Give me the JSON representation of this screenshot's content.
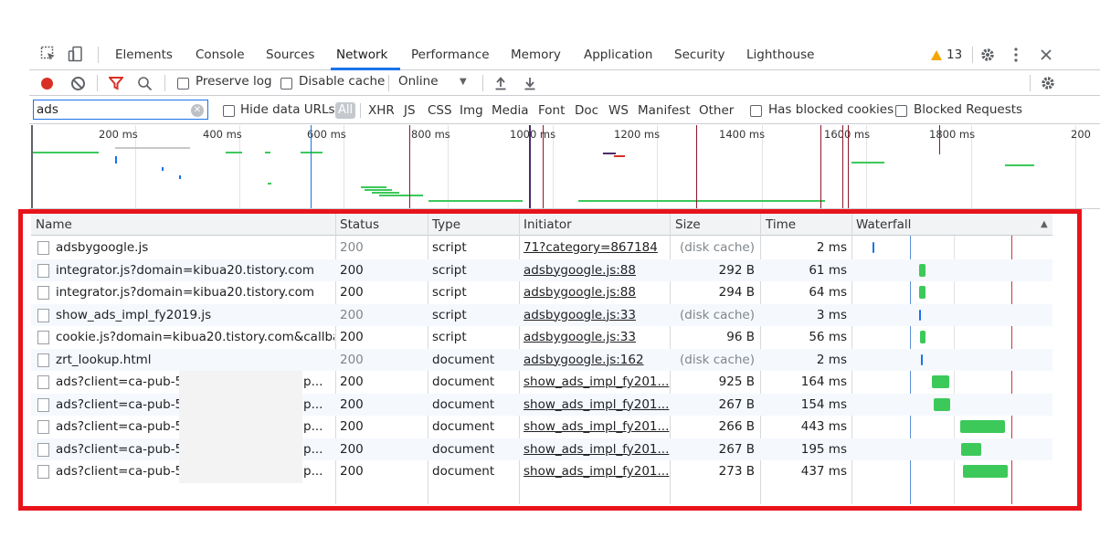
{
  "tabs": [
    "Elements",
    "Console",
    "Sources",
    "Network",
    "Performance",
    "Memory",
    "Application",
    "Security",
    "Lighthouse"
  ],
  "active_tab": "Network",
  "warning_count": "13",
  "toolbar": {
    "preserve_log": "Preserve log",
    "disable_cache": "Disable cache",
    "throttling": "Online"
  },
  "filter": {
    "value": "ads",
    "hide_data_urls": "Hide data URLs",
    "all_label": "All",
    "types": [
      "XHR",
      "JS",
      "CSS",
      "Img",
      "Media",
      "Font",
      "Doc",
      "WS",
      "Manifest",
      "Other"
    ],
    "has_blocked_cookies": "Has blocked cookies",
    "blocked_requests": "Blocked Requests"
  },
  "overview": {
    "ticks": [
      "200 ms",
      "400 ms",
      "600 ms",
      "800 ms",
      "1000 ms",
      "1200 ms",
      "1400 ms",
      "1600 ms",
      "1800 ms",
      "200"
    ]
  },
  "table": {
    "headers": [
      "Name",
      "Status",
      "Type",
      "Initiator",
      "Size",
      "Time",
      "Waterfall"
    ],
    "sort_icon": "▲",
    "rows": [
      {
        "name": "adsbygoogle.js",
        "name_suffix": "",
        "status": "200",
        "type": "script",
        "initiator": "71?category=867184",
        "size": "(disk cache)",
        "time": "2 ms",
        "masked": false,
        "gray_status": true
      },
      {
        "name": "integrator.js?domain=kibua20.tistory.com",
        "name_suffix": "",
        "status": "200",
        "type": "script",
        "initiator": "adsbygoogle.js:88",
        "size": "292 B",
        "time": "61 ms",
        "masked": false,
        "gray_status": false
      },
      {
        "name": "integrator.js?domain=kibua20.tistory.com",
        "name_suffix": "",
        "status": "200",
        "type": "script",
        "initiator": "adsbygoogle.js:88",
        "size": "294 B",
        "time": "64 ms",
        "masked": false,
        "gray_status": false
      },
      {
        "name": "show_ads_impl_fy2019.js",
        "name_suffix": "",
        "status": "200",
        "type": "script",
        "initiator": "adsbygoogle.js:33",
        "size": "(disk cache)",
        "time": "3 ms",
        "masked": false,
        "gray_status": true
      },
      {
        "name": "cookie.js?domain=kibua20.tistory.com&callba...",
        "name_suffix": "",
        "status": "200",
        "type": "script",
        "initiator": "adsbygoogle.js:33",
        "size": "96 B",
        "time": "56 ms",
        "masked": false,
        "gray_status": false
      },
      {
        "name": "zrt_lookup.html",
        "name_suffix": "",
        "status": "200",
        "type": "document",
        "initiator": "adsbygoogle.js:162",
        "size": "(disk cache)",
        "time": "2 ms",
        "masked": false,
        "gray_status": true
      },
      {
        "name": "ads?client=ca-pub-51!",
        "name_suffix": "p...",
        "status": "200",
        "type": "document",
        "initiator": "show_ads_impl_fy201...",
        "size": "925 B",
        "time": "164 ms",
        "masked": true,
        "gray_status": false
      },
      {
        "name": "ads?client=ca-pub-51!",
        "name_suffix": "p...",
        "status": "200",
        "type": "document",
        "initiator": "show_ads_impl_fy201...",
        "size": "267 B",
        "time": "154 ms",
        "masked": true,
        "gray_status": false
      },
      {
        "name": "ads?client=ca-pub-51!",
        "name_suffix": "p...",
        "status": "200",
        "type": "document",
        "initiator": "show_ads_impl_fy201...",
        "size": "266 B",
        "time": "443 ms",
        "masked": true,
        "gray_status": false
      },
      {
        "name": "ads?client=ca-pub-51!",
        "name_suffix": "p...",
        "status": "200",
        "type": "document",
        "initiator": "show_ads_impl_fy201...",
        "size": "267 B",
        "time": "195 ms",
        "masked": true,
        "gray_status": false
      },
      {
        "name": "ads?client=ca-pub-51!",
        "name_suffix": "p...",
        "status": "200",
        "type": "document",
        "initiator": "show_ads_impl_fy201...",
        "size": "273 B",
        "time": "437 ms",
        "masked": true,
        "gray_status": false
      }
    ]
  },
  "colors": {
    "active_tab_underline": "#1a73e8",
    "record": "#d93025",
    "waterfall_bar": "#3cc95a",
    "highlight": "#e8141c",
    "warning": "#f2a600"
  },
  "icons": [
    "inspect-icon",
    "device-toolbar-icon",
    "warning-icon",
    "settings-gear-icon",
    "more-vertical-icon",
    "close-icon",
    "record-icon",
    "clear-icon",
    "filter-icon",
    "search-icon",
    "dropdown-caret-icon",
    "import-har-icon",
    "export-har-icon",
    "network-settings-icon",
    "file-icon",
    "filter-clear-icon"
  ]
}
